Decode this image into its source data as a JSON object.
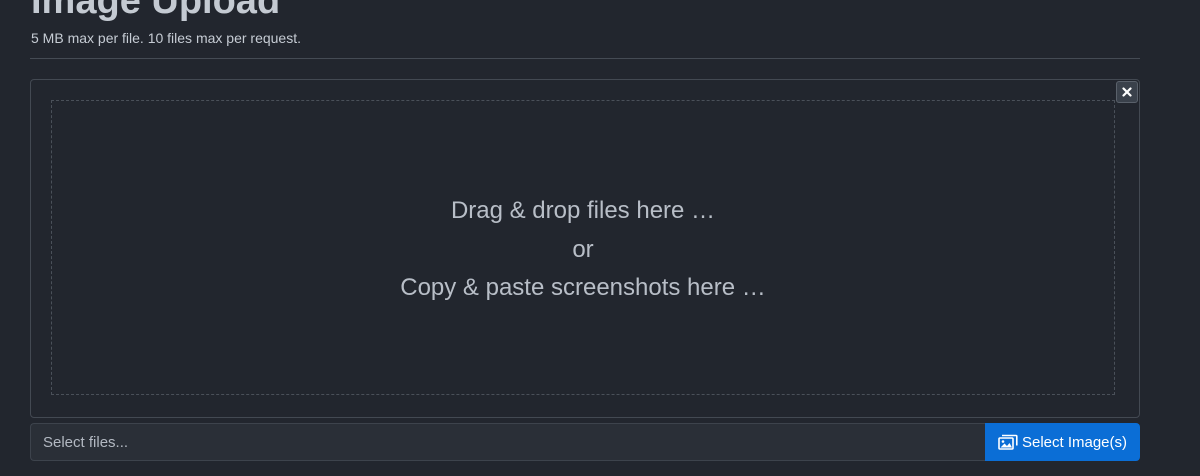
{
  "header": {
    "title": "Image Upload",
    "subtitle": "5 MB max per file. 10 files max per request."
  },
  "dropzone": {
    "line1": "Drag & drop files here …",
    "line2": "or",
    "line3": "Copy & paste screenshots here …",
    "close_icon": "close-icon"
  },
  "file_input": {
    "placeholder": "Select files..."
  },
  "select_button": {
    "label": "Select Image(s)",
    "icon": "images-icon",
    "color": "#0b6ed6"
  }
}
